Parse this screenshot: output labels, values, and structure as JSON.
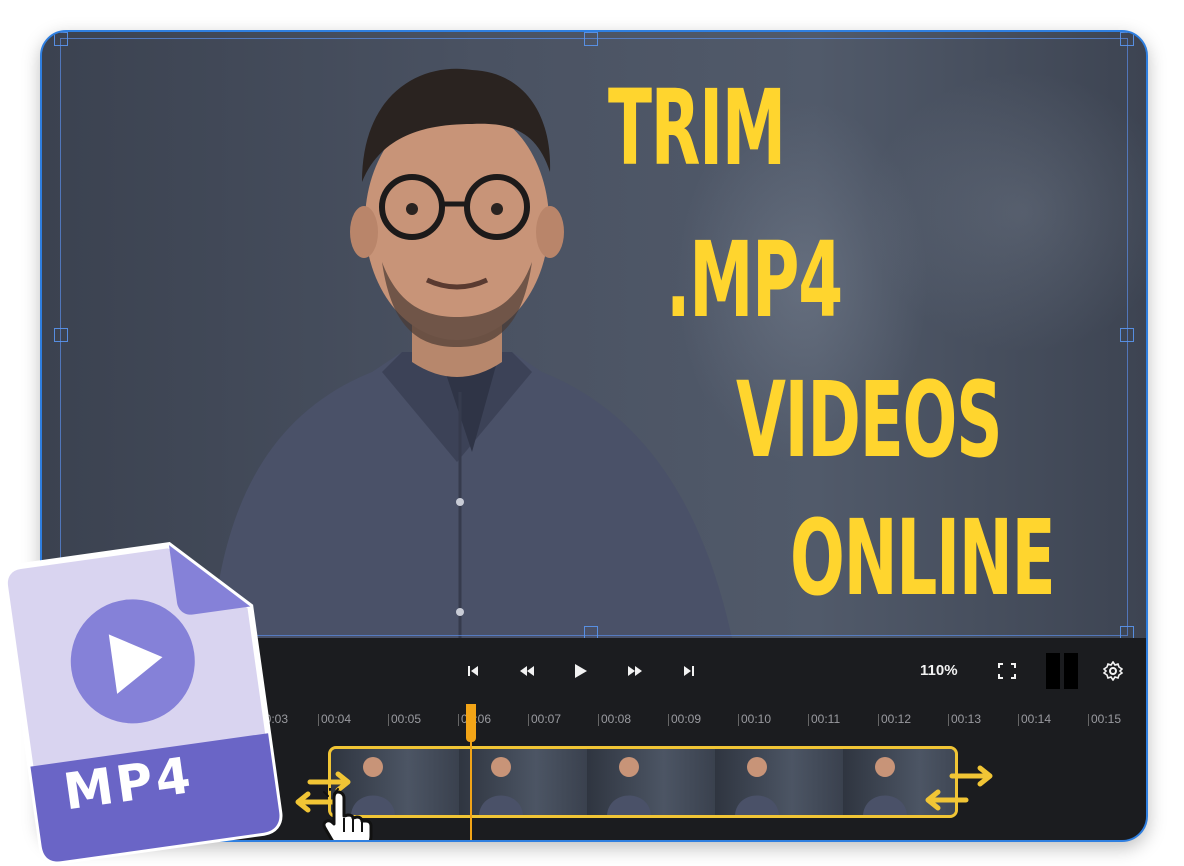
{
  "headline": {
    "line1": "TRIM",
    "line2": ".MP4",
    "line3": "VIDEOS",
    "line4": "ONLINE"
  },
  "controls": {
    "zoom": "110%",
    "icons": [
      "skip-back-icon",
      "rewind-icon",
      "play-icon",
      "fast-forward-icon",
      "skip-forward-icon",
      "fullscreen-icon",
      "split-icon",
      "settings-icon"
    ]
  },
  "timeline": {
    "ticks": [
      "00:03",
      "00:04",
      "00:05",
      "00:06",
      "00:07",
      "00:08",
      "00:09",
      "00:10",
      "00:11",
      "00:12",
      "00:13",
      "00:14",
      "00:15"
    ]
  },
  "badge": {
    "label": "MP4"
  },
  "colors": {
    "accent": "#ffd52e",
    "clip_border": "#f1c535",
    "playhead": "#f2a417",
    "badge_purple": "#6a65c6"
  }
}
